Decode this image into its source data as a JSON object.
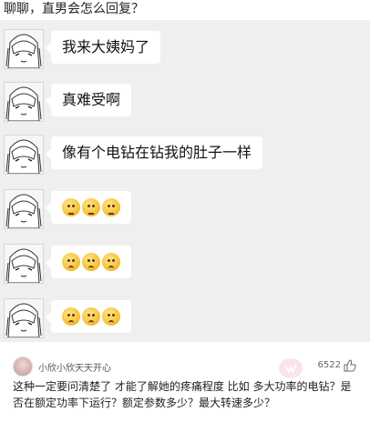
{
  "header": {
    "title": "聊聊，直男会怎么回复？"
  },
  "chat": {
    "messages": [
      {
        "text": "我来大姨妈了"
      },
      {
        "text": "真难受啊"
      },
      {
        "text": "像有个电钻在钻我的肚子一样"
      },
      {
        "emojis": [
          "grimace-emoji",
          "grimace-emoji",
          "grimace-emoji"
        ]
      },
      {
        "emojis": [
          "worried-emoji",
          "worried-emoji",
          "worried-emoji"
        ]
      },
      {
        "emojis": [
          "sad-emoji",
          "sad-emoji",
          "sad-emoji"
        ]
      }
    ]
  },
  "comment": {
    "author": "小欣小欣天天开心",
    "likes": "6522",
    "text": "这种一定要问清楚了 才能了解她的疼痛程度 比如 多大功率的电钻？是否在额定功率下运行？额定参数多少？最大转速多少？"
  },
  "colors": {
    "chat_background": "#efefef",
    "bubble": "#ffffff",
    "emoji_yellow": "#f6c23a"
  }
}
